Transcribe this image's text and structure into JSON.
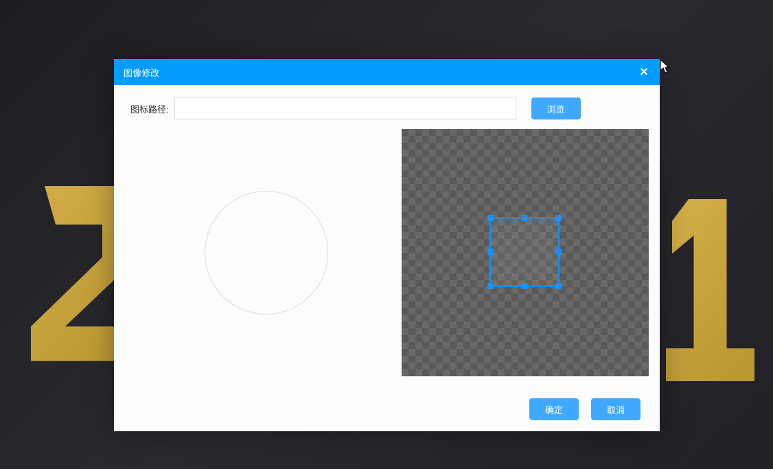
{
  "modal": {
    "title": "图像修改",
    "path_label": "图标路径:",
    "path_value": "",
    "browse_label": "浏览",
    "ok_label": "确定",
    "cancel_label": "取消"
  }
}
